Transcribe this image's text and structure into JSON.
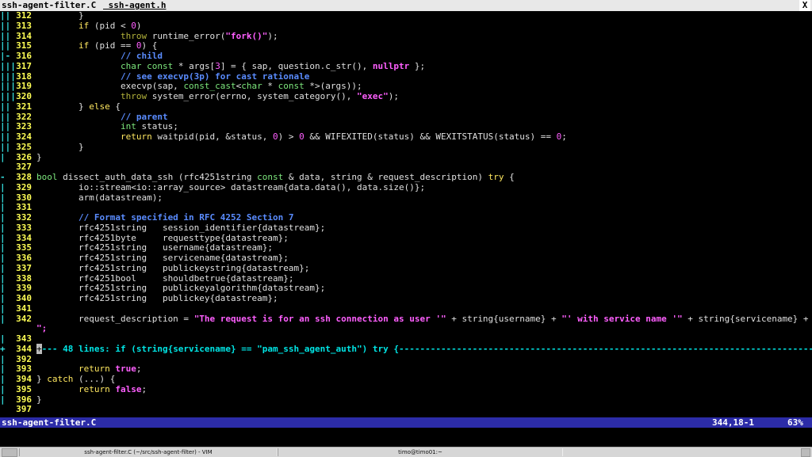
{
  "tabs": [
    {
      "label": "ssh-agent-filter.C"
    },
    {
      "label": " ssh-agent.h"
    }
  ],
  "tab_close": "X",
  "lines": [
    {
      "fold": "||",
      "num": "312",
      "segs": [
        [
          "pl",
          "        }"
        ]
      ]
    },
    {
      "fold": "||",
      "num": "313",
      "segs": [
        [
          "kw",
          "        if"
        ],
        [
          "pl",
          " (pid < "
        ],
        [
          "num2",
          "0"
        ],
        [
          "pl",
          ")"
        ]
      ]
    },
    {
      "fold": "||",
      "num": "314",
      "segs": [
        [
          "th",
          "                throw"
        ],
        [
          "pl",
          " runtime_error("
        ],
        [
          "str",
          "\"fork()\""
        ],
        [
          "pl",
          ");"
        ]
      ]
    },
    {
      "fold": "||",
      "num": "315",
      "segs": [
        [
          "kw",
          "        if"
        ],
        [
          "pl",
          " (pid == "
        ],
        [
          "num2",
          "0"
        ],
        [
          "pl",
          ") {"
        ]
      ]
    },
    {
      "fold": "|-",
      "num": "316",
      "segs": [
        [
          "cm",
          "                // child"
        ]
      ]
    },
    {
      "fold": "|||",
      "num": "317",
      "segs": [
        [
          "ty",
          "                char"
        ],
        [
          "ty",
          " const"
        ],
        [
          "pl",
          " * args["
        ],
        [
          "num2",
          "3"
        ],
        [
          "pl",
          "] = { sap, question.c_str(), "
        ],
        [
          "str",
          "nullptr"
        ],
        [
          "pl",
          " };"
        ]
      ]
    },
    {
      "fold": "|||",
      "num": "318",
      "segs": [
        [
          "cm",
          "                // see execvp(3p) for cast rationale"
        ]
      ]
    },
    {
      "fold": "|||",
      "num": "319",
      "segs": [
        [
          "pl",
          "                execvp(sap, "
        ],
        [
          "ty",
          "const_cast"
        ],
        [
          "pl",
          "<"
        ],
        [
          "ty",
          "char"
        ],
        [
          "pl",
          " * "
        ],
        [
          "ty",
          "const"
        ],
        [
          "pl",
          " *>(args));"
        ]
      ]
    },
    {
      "fold": "|||",
      "num": "320",
      "segs": [
        [
          "th",
          "                throw"
        ],
        [
          "pl",
          " system_error(errno, system_category(), "
        ],
        [
          "str",
          "\"exec\""
        ],
        [
          "pl",
          ");"
        ]
      ]
    },
    {
      "fold": "||",
      "num": "321",
      "segs": [
        [
          "pl",
          "        } "
        ],
        [
          "kw",
          "else"
        ],
        [
          "pl",
          " {"
        ]
      ]
    },
    {
      "fold": "||",
      "num": "322",
      "segs": [
        [
          "cm",
          "                // parent"
        ]
      ]
    },
    {
      "fold": "||",
      "num": "323",
      "segs": [
        [
          "ty",
          "                int"
        ],
        [
          "pl",
          " status;"
        ]
      ]
    },
    {
      "fold": "||",
      "num": "324",
      "segs": [
        [
          "kw",
          "                return"
        ],
        [
          "pl",
          " waitpid(pid, &status, "
        ],
        [
          "num2",
          "0"
        ],
        [
          "pl",
          ") > "
        ],
        [
          "num2",
          "0"
        ],
        [
          "pl",
          " && WIFEXITED(status) && WEXITSTATUS(status) == "
        ],
        [
          "num2",
          "0"
        ],
        [
          "pl",
          ";"
        ]
      ]
    },
    {
      "fold": "||",
      "num": "325",
      "segs": [
        [
          "pl",
          "        }"
        ]
      ]
    },
    {
      "fold": "|",
      "num": "326",
      "segs": [
        [
          "pl",
          "}"
        ]
      ]
    },
    {
      "fold": "",
      "num": "327",
      "segs": []
    },
    {
      "fold": "-",
      "num": "328",
      "segs": [
        [
          "ty",
          "bool"
        ],
        [
          "pl",
          " dissect_auth_data_ssh (rfc4251string "
        ],
        [
          "ty",
          "const"
        ],
        [
          "pl",
          " & data, string & request_description) "
        ],
        [
          "kw",
          "try"
        ],
        [
          "pl",
          " {"
        ]
      ]
    },
    {
      "fold": "|",
      "num": "329",
      "segs": [
        [
          "pl",
          "        io::stream<io::array_source> datastream{data.data(), data.size()};"
        ]
      ]
    },
    {
      "fold": "|",
      "num": "330",
      "segs": [
        [
          "pl",
          "        arm(datastream);"
        ]
      ]
    },
    {
      "fold": "|",
      "num": "331",
      "segs": []
    },
    {
      "fold": "|",
      "num": "332",
      "segs": [
        [
          "cm",
          "        // Format specified in RFC 4252 Section 7"
        ]
      ]
    },
    {
      "fold": "|",
      "num": "333",
      "segs": [
        [
          "pl",
          "        rfc4251string   session_identifier{datastream};"
        ]
      ]
    },
    {
      "fold": "|",
      "num": "334",
      "segs": [
        [
          "pl",
          "        rfc4251byte     requesttype{datastream};"
        ]
      ]
    },
    {
      "fold": "|",
      "num": "335",
      "segs": [
        [
          "pl",
          "        rfc4251string   username{datastream};"
        ]
      ]
    },
    {
      "fold": "|",
      "num": "336",
      "segs": [
        [
          "pl",
          "        rfc4251string   servicename{datastream};"
        ]
      ]
    },
    {
      "fold": "|",
      "num": "337",
      "segs": [
        [
          "pl",
          "        rfc4251string   publickeystring{datastream};"
        ]
      ]
    },
    {
      "fold": "|",
      "num": "338",
      "segs": [
        [
          "pl",
          "        rfc4251bool     shouldbetrue{datastream};"
        ]
      ]
    },
    {
      "fold": "|",
      "num": "339",
      "segs": [
        [
          "pl",
          "        rfc4251string   publickeyalgorithm{datastream};"
        ]
      ]
    },
    {
      "fold": "|",
      "num": "340",
      "segs": [
        [
          "pl",
          "        rfc4251string   publickey{datastream};"
        ]
      ]
    },
    {
      "fold": "|",
      "num": "341",
      "segs": []
    },
    {
      "fold": "|",
      "num": "342",
      "segs": [
        [
          "pl",
          "        request_description = "
        ],
        [
          "str",
          "\"The request is for an ssh connection as user '\""
        ],
        [
          "pl",
          " + string{username} + "
        ],
        [
          "str",
          "\"' with service name '\""
        ],
        [
          "pl",
          " + string{servicename} + "
        ],
        [
          "str",
          "\"'."
        ]
      ]
    },
    {
      "fold": "",
      "num": "",
      "segs": [
        [
          "str",
          "\";"
        ]
      ],
      "wrap": true
    },
    {
      "fold": "|",
      "num": "343",
      "segs": []
    },
    {
      "fold": "+",
      "num": "344",
      "closed": true,
      "text": "--- 48 lines: if (string{servicename} == \"pam_ssh_agent_auth\") try {-------------------------------------------------------------------------------------"
    },
    {
      "fold": "|",
      "num": "392",
      "segs": []
    },
    {
      "fold": "|",
      "num": "393",
      "segs": [
        [
          "kw",
          "        return"
        ],
        [
          "pl",
          " "
        ],
        [
          "str",
          "true"
        ],
        [
          "pl",
          ";"
        ]
      ]
    },
    {
      "fold": "|",
      "num": "394",
      "segs": [
        [
          "pl",
          "} "
        ],
        [
          "kw",
          "catch"
        ],
        [
          "pl",
          " (...) {"
        ]
      ]
    },
    {
      "fold": "|",
      "num": "395",
      "segs": [
        [
          "kw",
          "        return"
        ],
        [
          "pl",
          " "
        ],
        [
          "str",
          "false"
        ],
        [
          "pl",
          ";"
        ]
      ]
    },
    {
      "fold": "|",
      "num": "396",
      "segs": [
        [
          "pl",
          "}"
        ]
      ]
    },
    {
      "fold": "",
      "num": "397",
      "segs": []
    }
  ],
  "status": {
    "file": "ssh-agent-filter.C",
    "position": "344,18-1",
    "percent": "63%"
  },
  "taskbar": {
    "vim_task": "ssh-agent-filter.C (~/src/ssh-agent-filter) - VIM",
    "term_task": "timo@timo01:~"
  },
  "colors": {
    "line_number": "#ffff55",
    "fold_column": "#35e2e2",
    "statusline_bg": "#2c2ca8",
    "keyword": "#ffe860",
    "type": "#7ce67c",
    "comment": "#5a8cff",
    "string": "#ff5fff"
  }
}
